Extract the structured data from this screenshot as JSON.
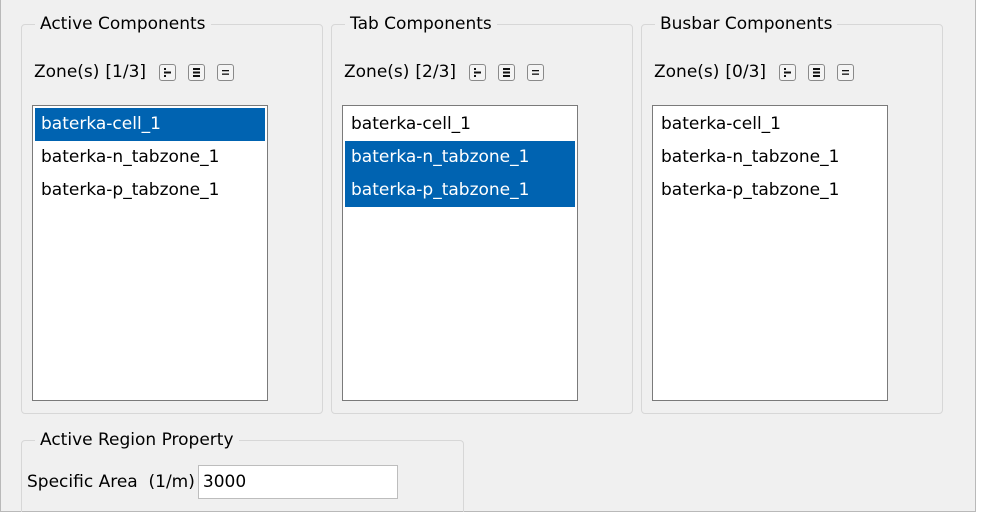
{
  "groups": [
    {
      "title": "Active Components",
      "zone_label": "Zone(s)",
      "zone_count": "[1/3]",
      "items": [
        {
          "label": "baterka-cell_1",
          "selected": true
        },
        {
          "label": "baterka-n_tabzone_1",
          "selected": false
        },
        {
          "label": "baterka-p_tabzone_1",
          "selected": false
        }
      ]
    },
    {
      "title": "Tab Components",
      "zone_label": "Zone(s)",
      "zone_count": "[2/3]",
      "items": [
        {
          "label": "baterka-cell_1",
          "selected": false
        },
        {
          "label": "baterka-n_tabzone_1",
          "selected": true
        },
        {
          "label": "baterka-p_tabzone_1",
          "selected": true
        }
      ]
    },
    {
      "title": "Busbar Components",
      "zone_label": "Zone(s)",
      "zone_count": "[0/3]",
      "items": [
        {
          "label": "baterka-cell_1",
          "selected": false
        },
        {
          "label": "baterka-n_tabzone_1",
          "selected": false
        },
        {
          "label": "baterka-p_tabzone_1",
          "selected": false
        }
      ]
    }
  ],
  "zone_buttons": [
    "select-highlighted-icon",
    "select-all-icon",
    "deselect-all-icon"
  ],
  "region": {
    "title": "Active Region Property",
    "field_label": "Specific Area  (1/m)",
    "field_value": "3000"
  },
  "colors": {
    "panel_background": "#f0f0f0",
    "selection": "#0063b1",
    "group_border": "#d7d7d7"
  }
}
